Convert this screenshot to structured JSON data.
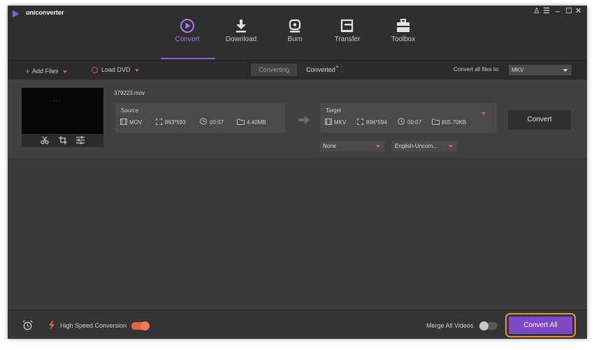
{
  "app": {
    "name": "uniconverter"
  },
  "window_controls": [
    "user-icon",
    "menu-icon",
    "minimize-icon",
    "maximize-icon",
    "close-icon"
  ],
  "window_control_glyphs": [
    "♙",
    "☰",
    "_",
    "☐",
    "✕"
  ],
  "nav": {
    "tabs": [
      {
        "label": "Convert",
        "icon": "convert-icon",
        "active": true
      },
      {
        "label": "Download",
        "icon": "download-icon",
        "active": false
      },
      {
        "label": "Burn",
        "icon": "burn-icon",
        "active": false
      },
      {
        "label": "Transfer",
        "icon": "transfer-icon",
        "active": false
      },
      {
        "label": "Toolbox",
        "icon": "toolbox-icon",
        "active": false
      }
    ]
  },
  "toolbar": {
    "add_files": "Add Files",
    "load_dvd": "Load DVD",
    "tab_converting": "Converting",
    "tab_converted": "Converted",
    "convert_all_label": "Convert all files to:",
    "convert_all_format": "MKV"
  },
  "file": {
    "name": "379223.mov",
    "thumb_mark": "· ·",
    "source": {
      "label": "Source",
      "format": "MOV",
      "resolution": "863*593",
      "duration": "00:07",
      "size": "4.40MB"
    },
    "target": {
      "label": "Target",
      "format": "MKV",
      "resolution": "896*594",
      "duration": "00:07",
      "size": "805.70KB"
    },
    "subtitle": "None",
    "audio": "English-Uncom...",
    "convert_button": "Convert"
  },
  "bottom": {
    "high_speed": "High Speed Conversion",
    "high_speed_on": true,
    "merge": "Merge All Videos",
    "merge_on": false,
    "convert_all_button": "Convert All"
  },
  "colors": {
    "accent": "#8b5ad9",
    "orange": "#e0663b",
    "highlight_ring": "#e8923a",
    "bg": "#3a393b"
  }
}
